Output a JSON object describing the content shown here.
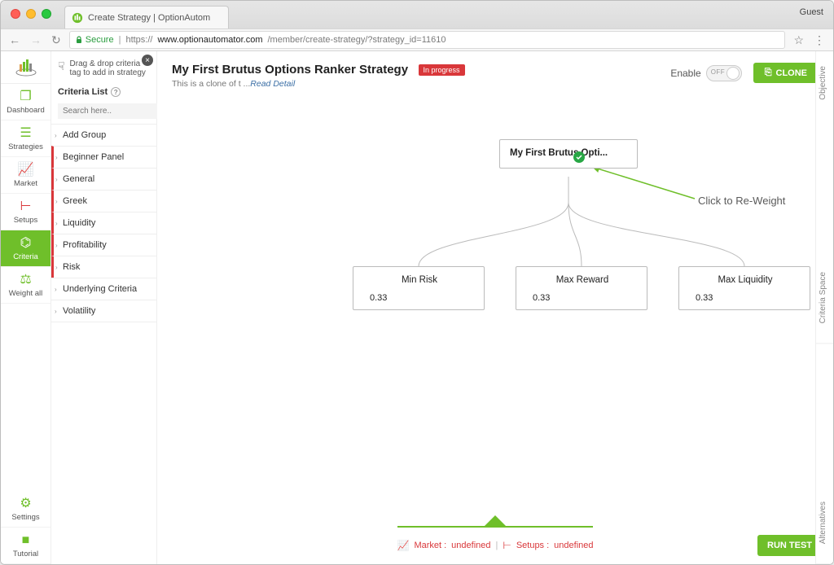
{
  "browser": {
    "tab_title": "Create Strategy | OptionAutom",
    "guest": "Guest",
    "secure_label": "Secure",
    "url_scheme": "https://",
    "url_host": "www.optionautomator.com",
    "url_path": "/member/create-strategy/?strategy_id=11610"
  },
  "sidebar": {
    "items": [
      {
        "label": "Dashboard",
        "icon": "dashboard-icon",
        "color": "green"
      },
      {
        "label": "Strategies",
        "icon": "list-icon",
        "color": "green"
      },
      {
        "label": "Market",
        "icon": "chart-icon",
        "color": "red"
      },
      {
        "label": "Setups",
        "icon": "setups-icon",
        "color": "red"
      },
      {
        "label": "Criteria",
        "icon": "criteria-icon",
        "color": "active"
      },
      {
        "label": "Weight all",
        "icon": "scale-icon",
        "color": "green"
      }
    ],
    "bottom": [
      {
        "label": "Settings",
        "icon": "gear-icon"
      },
      {
        "label": "Tutorial",
        "icon": "video-icon"
      }
    ]
  },
  "criteria": {
    "drag_hint": "Drag & drop criteria tag to add in strategy",
    "heading": "Criteria List",
    "search_placeholder": "Search here..",
    "items": [
      {
        "label": "Add Group",
        "active": false
      },
      {
        "label": "Beginner Panel",
        "active": true
      },
      {
        "label": "General",
        "active": true
      },
      {
        "label": "Greek",
        "active": true
      },
      {
        "label": "Liquidity",
        "active": true
      },
      {
        "label": "Profitability",
        "active": true
      },
      {
        "label": "Risk",
        "active": true
      },
      {
        "label": "Underlying Criteria",
        "active": false
      },
      {
        "label": "Volatility",
        "active": false
      }
    ]
  },
  "header": {
    "title": "My First Brutus Options Ranker Strategy",
    "badge": "In progress",
    "subtitle_prefix": "This is a clone of t ...",
    "subtitle_link": "Read Detail",
    "enable_label": "Enable",
    "toggle_off": "OFF",
    "clone": "CLONE"
  },
  "canvas": {
    "root": "My First Brutus Opti...",
    "annotation": "Click to Re-Weight",
    "children": [
      {
        "title": "Min Risk",
        "value": "0.33"
      },
      {
        "title": "Max Reward",
        "value": "0.33"
      },
      {
        "title": "Max Liquidity",
        "value": "0.33"
      }
    ]
  },
  "footer": {
    "market_label": "Market :",
    "market_value": "undefined",
    "setups_label": "Setups :",
    "setups_value": "undefined",
    "run": "RUN TEST"
  },
  "side_tabs": [
    "Objective",
    "Criteria Space",
    "Alternatives"
  ]
}
